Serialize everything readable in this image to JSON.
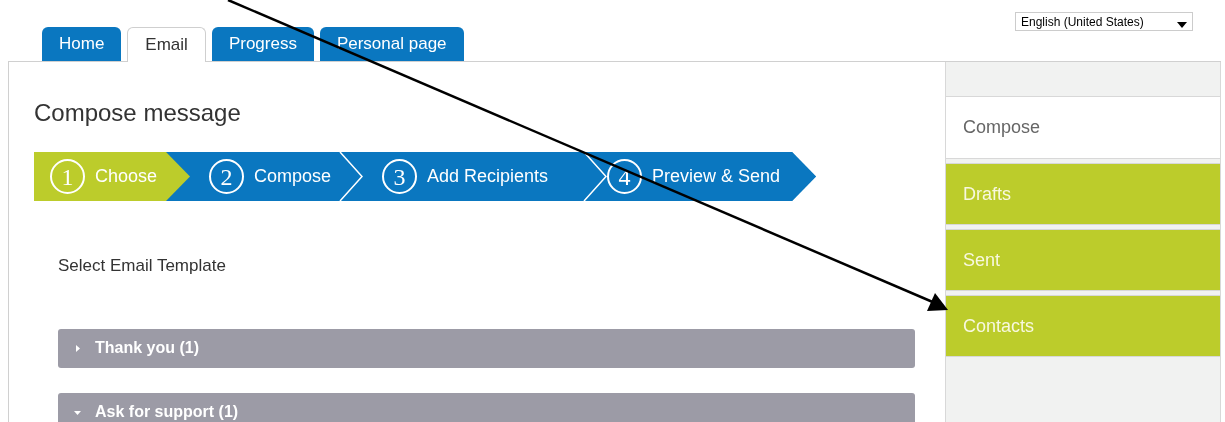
{
  "tabs": [
    {
      "label": "Home",
      "selected": false
    },
    {
      "label": "Email",
      "selected": true
    },
    {
      "label": "Progress",
      "selected": false
    },
    {
      "label": "Personal page",
      "selected": false
    }
  ],
  "language_select": {
    "value": "English (United States)"
  },
  "title": "Compose message",
  "steps": [
    {
      "number": "1",
      "label": "Choose",
      "selected": true
    },
    {
      "number": "2",
      "label": "Compose",
      "selected": false
    },
    {
      "number": "3",
      "label": "Add Recipients",
      "selected": false
    },
    {
      "number": "4",
      "label": "Preview & Send",
      "selected": false
    }
  ],
  "section_label": "Select Email Template",
  "templates": [
    {
      "label": "Thank you (1)",
      "expanded": false
    },
    {
      "label": "Ask for support (1)",
      "expanded": true
    }
  ],
  "sidebar": {
    "items": [
      {
        "label": "Compose",
        "selected": true
      },
      {
        "label": "Drafts",
        "selected": false
      },
      {
        "label": "Sent",
        "selected": false
      },
      {
        "label": "Contacts",
        "selected": false
      }
    ]
  }
}
